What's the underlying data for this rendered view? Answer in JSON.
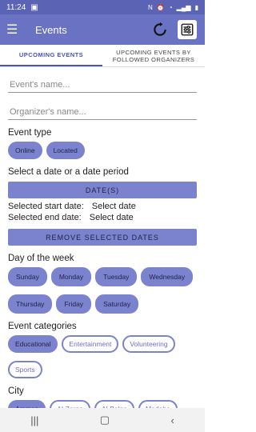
{
  "status": {
    "time": "11:24"
  },
  "appbar": {
    "title": "Events"
  },
  "tabs": [
    {
      "label": "UPCOMING EVENTS"
    },
    {
      "label": "UPCOMING EVENTS BY FOLLOWED ORGANIZERS"
    }
  ],
  "search": {
    "event_name_placeholder": "Event's name...",
    "organizer_name_placeholder": "Organizer's name..."
  },
  "event_type": {
    "label": "Event type",
    "options": [
      "Online",
      "Located"
    ]
  },
  "date": {
    "label": "Select a date or a date period",
    "button": "DATE(S)",
    "start_label": "Selected start date:",
    "start_value": "Select date",
    "end_label": "Selected end date:",
    "end_value": "Select date",
    "remove_button": "REMOVE SELECTED DATES"
  },
  "days": {
    "label": "Day of the week",
    "options": [
      "Sunday",
      "Monday",
      "Tuesday",
      "Wednesday",
      "Thursday",
      "Friday",
      "Saturday"
    ]
  },
  "categories": {
    "label": "Event categories",
    "options": [
      "Educational",
      "Entertainment",
      "Volunteering",
      "Sports"
    ]
  },
  "city": {
    "label": "City",
    "options": [
      "Amman",
      "Al-Zarqa",
      "Al-Balqa",
      "Madaba"
    ]
  }
}
